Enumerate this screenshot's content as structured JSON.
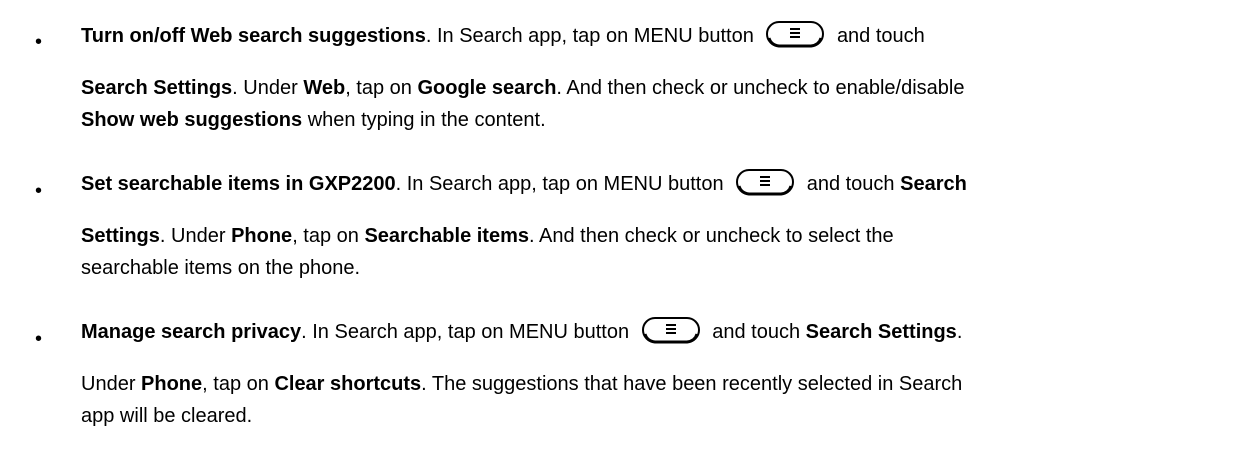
{
  "items": [
    {
      "title": "Turn on/off Web search suggestions",
      "l1_a": ". In Search app, tap on MENU button",
      "l1_b": "and touch",
      "l2_a": "Search Settings",
      "l2_b": ". Under ",
      "l2_c": "Web",
      "l2_d": ", tap on ",
      "l2_e": "Google search",
      "l2_f": ". And then check or uncheck to enable/disable",
      "l3_a": "Show web suggestions",
      "l3_b": " when typing in the content."
    },
    {
      "title": "Set searchable items in GXP2200",
      "l1_a": ". In Search app, tap on MENU button",
      "l1_b": "and touch ",
      "l1_c": "Search",
      "l2_a": "Settings",
      "l2_b": ". Under ",
      "l2_c": "Phone",
      "l2_d": ", tap on ",
      "l2_e": "Searchable items",
      "l2_f": ". And then check or uncheck to select the",
      "l3_a": "searchable items on the phone."
    },
    {
      "title": "Manage search privacy",
      "l1_a": ". In Search app, tap on MENU button",
      "l1_b": "and touch ",
      "l1_c": "Search Settings",
      "l1_d": ".",
      "l2_a": "Under ",
      "l2_b": "Phone",
      "l2_c": ", tap on ",
      "l2_d": "Clear shortcuts",
      "l2_e": ". The suggestions that have been recently selected in Search",
      "l3_a": "app will be cleared."
    }
  ],
  "bullet_char": "•",
  "icons": {
    "menu_button": "menu-button-icon"
  }
}
